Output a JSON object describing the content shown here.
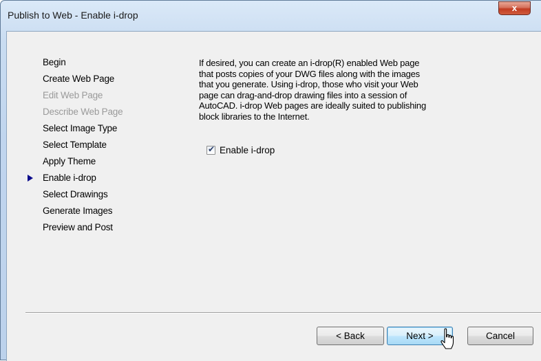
{
  "window": {
    "title": "Publish to Web - Enable i-drop",
    "close_label": "x"
  },
  "nav": {
    "items": [
      {
        "label": "Begin",
        "enabled": true
      },
      {
        "label": "Create Web Page",
        "enabled": true
      },
      {
        "label": "Edit Web Page",
        "enabled": false
      },
      {
        "label": "Describe Web Page",
        "enabled": false
      },
      {
        "label": "Select Image Type",
        "enabled": true
      },
      {
        "label": "Select Template",
        "enabled": true
      },
      {
        "label": "Apply Theme",
        "enabled": true
      },
      {
        "label": "Enable i-drop",
        "enabled": true,
        "current": true
      },
      {
        "label": "Select Drawings",
        "enabled": true
      },
      {
        "label": "Generate Images",
        "enabled": true
      },
      {
        "label": "Preview and Post",
        "enabled": true
      }
    ]
  },
  "content": {
    "description_lines": [
      "If desired, you can create an i-drop(R) enabled Web page",
      "that posts copies of your DWG files along with the images",
      "that you generate. Using i-drop, those who visit your Web",
      "page can drag-and-drop drawing files into a session of",
      "AutoCAD. i-drop Web pages are ideally suited to publishing",
      "block libraries to the Internet."
    ],
    "enable_checkbox": {
      "label": "Enable i-drop",
      "checked": true
    }
  },
  "buttons": {
    "back": "< Back",
    "next": "Next >",
    "cancel": "Cancel"
  }
}
